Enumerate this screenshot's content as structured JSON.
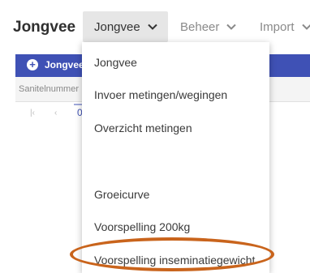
{
  "app": {
    "title": "Jongvee"
  },
  "nav": {
    "items": [
      {
        "label": "Jongvee",
        "icon": "chevron-down-icon",
        "active": true
      },
      {
        "label": "Beheer",
        "icon": "chevron-down-icon",
        "active": false
      },
      {
        "label": "Import",
        "icon": "chevron-down-icon",
        "active": false
      }
    ]
  },
  "background": {
    "add_button_label": "Jongvee",
    "add_icon": "plus-circle-icon",
    "column_header": "Sanitelnummer",
    "pager": {
      "first_icon": "first-page-icon",
      "prev_icon": "previous-page-icon",
      "current_page": "0"
    }
  },
  "dropdown": {
    "items": [
      {
        "label": "Jongvee"
      },
      {
        "label": "Invoer metingen/wegingen"
      },
      {
        "label": "Overzicht metingen"
      },
      {
        "label": ""
      },
      {
        "label": "Groeicurve"
      },
      {
        "label": "Voorspelling 200kg"
      },
      {
        "label": "Voorspelling inseminatiegewicht",
        "highlighted": true
      }
    ]
  },
  "colors": {
    "accent": "#3f51b5",
    "highlight_ring": "#c9641c",
    "active_nav_bg": "#e6e6e6"
  }
}
